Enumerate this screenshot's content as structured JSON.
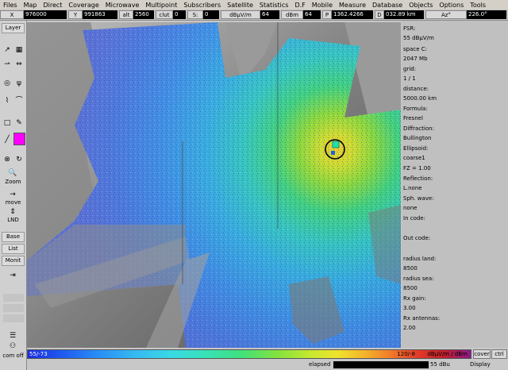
{
  "menu": [
    "Files",
    "Map",
    "Direct",
    "Coverage",
    "Microwave",
    "Multipoint",
    "Subscribers",
    "Satellite",
    "Statistics",
    "D.F",
    "Mobile",
    "Measure",
    "Database",
    "Objects",
    "Options",
    "Tools"
  ],
  "coords": {
    "x_label": "X",
    "x_value": "976000",
    "y_label": "Y",
    "y_value": "991863",
    "alt_label": "alt",
    "alt_value": "2560",
    "clut_label": "clut",
    "clut_value": "0",
    "s_label": "S:",
    "s_value": "0",
    "unit1": "dBμV/m",
    "unit1_value": "64",
    "unit2": "dBm",
    "unit2_value": "64",
    "p_label": "P",
    "p_value": "1362.4266",
    "d_label": "D",
    "d_value": "032.89 km",
    "az_label": "Az°",
    "az_value": "226.0°"
  },
  "toolbar": {
    "layer": "Layer",
    "zoom": "Zoom",
    "move": "move",
    "lnd": "LND",
    "base": "Base",
    "list": "List",
    "monit": "Monit",
    "comoff": "com off",
    "accent_color": "#ff00ff"
  },
  "info": {
    "fsr_label": "FSR:",
    "fsr_value": "55 dBμV/m",
    "space_label": "space C:",
    "space_value": "2047 Mb",
    "grid_label": "grid:",
    "grid_value": "1 / 1",
    "distance_label": "distance:",
    "distance_value": "5000.00 km",
    "formula_label": "Formula:",
    "formula_value": "Fresnel",
    "diffraction_label": "Diffraction:",
    "diffraction_value": "Bullington",
    "ellipsoid_label": "Ellipsoid:",
    "ellipsoid_value": "coarse1",
    "fz_value": "FZ = 1.00",
    "reflection_label": "Reflection:",
    "reflection_value": "L.none",
    "sph_label": "Sph. wave:",
    "sph_value": "none",
    "incode_label": "In code:",
    "outcode_label": "Out code:",
    "radius_land_label": "radius land:",
    "radius_land_value": "8500",
    "radius_sea_label": "radius sea:",
    "radius_sea_value": "8500",
    "rxgain_label": "Rx gain:",
    "rxgain_value": "3.00",
    "rxant_label": "Rx antennas:",
    "rxant_value": "2.00"
  },
  "legend": {
    "min_label": "55/-73",
    "max_label": "120/-8",
    "unit_label": "dBμV/m / dBm",
    "cover_label": "cover",
    "ctrl_label": "ctrl"
  },
  "status": {
    "elapsed_label": "elapsed",
    "fsr_display": "55 dBu",
    "display_label": "Display"
  }
}
